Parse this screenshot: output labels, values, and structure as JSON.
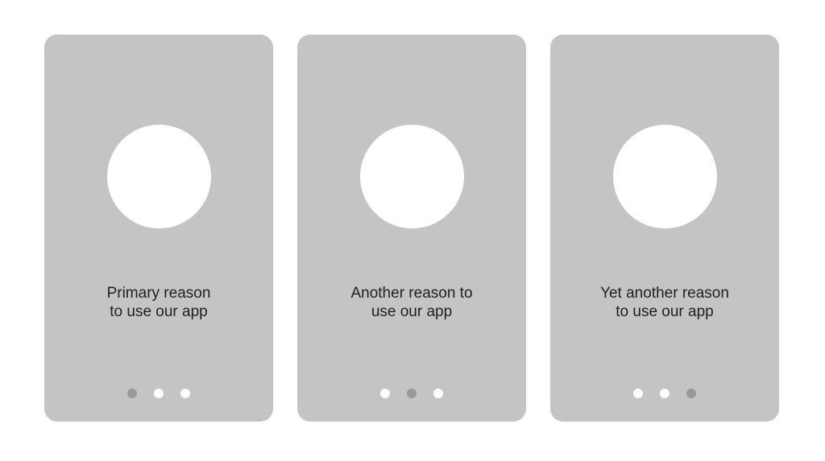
{
  "colors": {
    "card_background": "#c4c4c4",
    "illustration": "#ffffff",
    "dot_active": "#999999",
    "dot_inactive": "#ffffff"
  },
  "slides": [
    {
      "illustration_icon": "circle-placeholder",
      "text": "Primary reason\nto use our app",
      "active_page": 1,
      "page_count": 3
    },
    {
      "illustration_icon": "circle-placeholder",
      "text": "Another reason to\nuse our app",
      "active_page": 2,
      "page_count": 3
    },
    {
      "illustration_icon": "circle-placeholder",
      "text": "Yet another reason\nto use our app",
      "active_page": 3,
      "page_count": 3
    }
  ]
}
